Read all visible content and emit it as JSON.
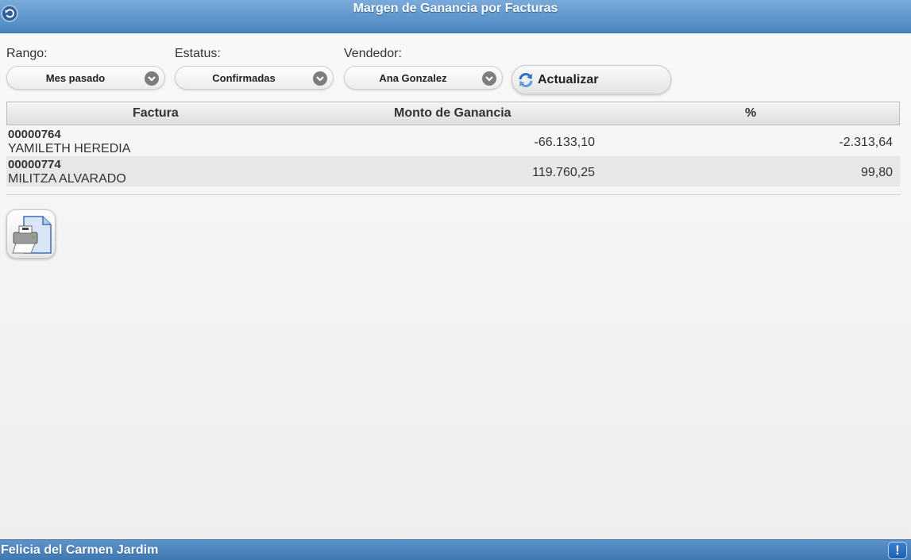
{
  "header": {
    "title": "Margen de Ganancia por Facturas",
    "back_icon": "back-arrow-icon"
  },
  "filters": {
    "range": {
      "label": "Rango:",
      "value": "Mes pasado"
    },
    "status": {
      "label": "Estatus:",
      "value": "Confirmadas"
    },
    "seller": {
      "label": "Vendedor:",
      "value": "Ana Gonzalez"
    },
    "refresh_label": "Actualizar"
  },
  "table": {
    "columns": [
      "Factura",
      "Monto de Ganancia",
      "%"
    ],
    "rows": [
      {
        "invoice": "00000764",
        "customer": "YAMILETH HEREDIA",
        "amount": "-66.133,10",
        "percent": "-2.313,64"
      },
      {
        "invoice": "00000774",
        "customer": "MILITZA ALVARADO",
        "amount": "119.760,25",
        "percent": "99,80"
      }
    ]
  },
  "print_icon": "printer-icon",
  "footer": {
    "user": "Felicia del Carmen Jardim",
    "alert_label": "!"
  },
  "colors": {
    "header_top": "#7aaad9",
    "header_bottom": "#4a85c1",
    "footer": "#4a85c1"
  }
}
